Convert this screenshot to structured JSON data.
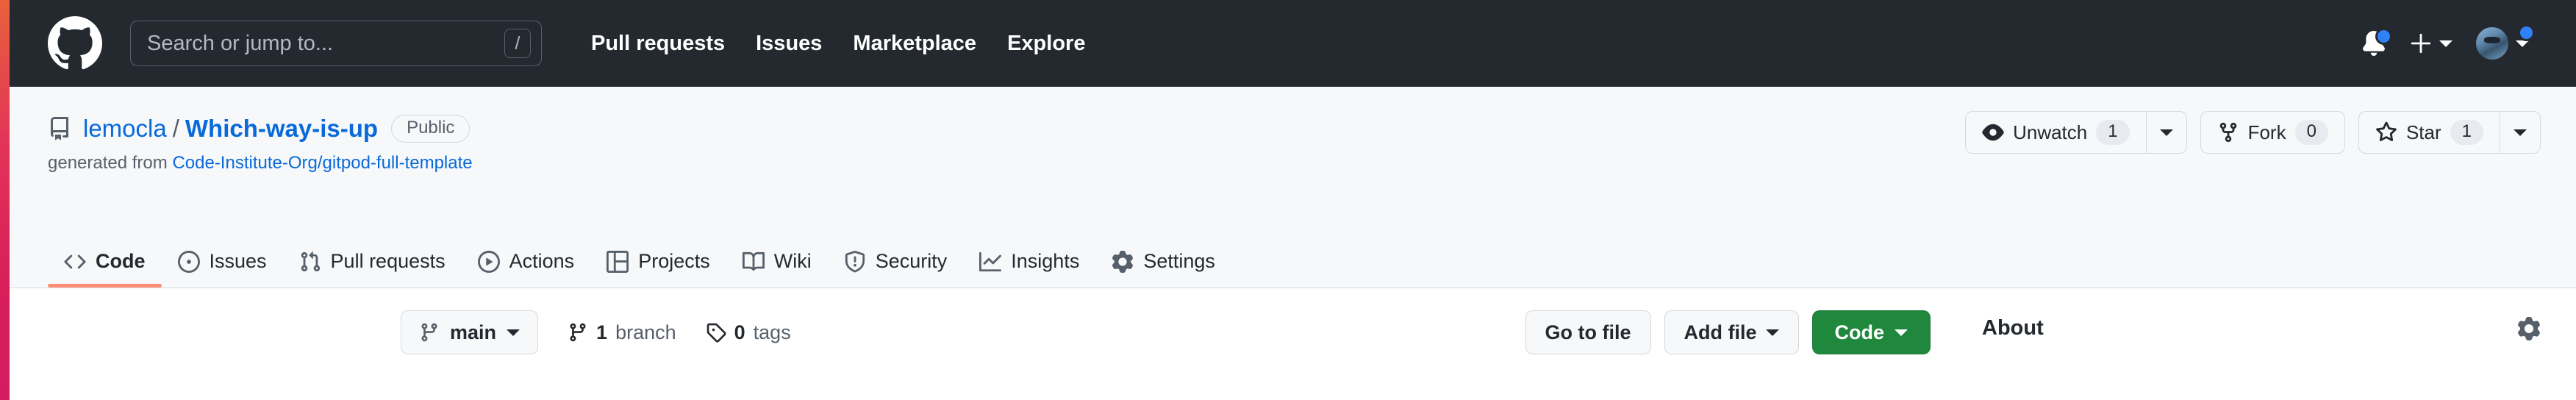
{
  "colors": {
    "header_bg": "#24292f",
    "repo_header_bg": "#f6f8fa",
    "link": "#0969da",
    "accent_underline": "#fd8c73",
    "code_button": "#1f883d",
    "notification_dot": "#2f81f7",
    "left_stripe": "#d81f5a"
  },
  "global_header": {
    "logo_icon": "github-mark-icon",
    "search": {
      "placeholder": "Search or jump to...",
      "value": "",
      "shortcut": "/"
    },
    "nav": [
      {
        "label": "Pull requests"
      },
      {
        "label": "Issues"
      },
      {
        "label": "Marketplace"
      },
      {
        "label": "Explore"
      }
    ],
    "right": {
      "notifications_icon": "bell-icon",
      "create_new_icon": "plus-icon",
      "avatar_icon": "avatar",
      "has_notification_dot": true
    }
  },
  "repo": {
    "icon": "repo-icon",
    "owner": "lemocla",
    "separator": "/",
    "name": "Which-way-is-up",
    "visibility": "Public",
    "generated_from_prefix": "generated from",
    "generated_from_link": "Code-Institute-Org/gitpod-full-template",
    "actions": {
      "watch": {
        "icon": "eye-icon",
        "label": "Unwatch",
        "count": "1"
      },
      "fork": {
        "icon": "fork-icon",
        "label": "Fork",
        "count": "0"
      },
      "star": {
        "icon": "star-icon",
        "label": "Star",
        "count": "1"
      }
    }
  },
  "tabs": [
    {
      "label": "Code",
      "icon": "code-icon",
      "active": true
    },
    {
      "label": "Issues",
      "icon": "issue-opened-icon",
      "active": false
    },
    {
      "label": "Pull requests",
      "icon": "git-pull-request-icon",
      "active": false
    },
    {
      "label": "Actions",
      "icon": "play-icon",
      "active": false
    },
    {
      "label": "Projects",
      "icon": "project-table-icon",
      "active": false
    },
    {
      "label": "Wiki",
      "icon": "book-icon",
      "active": false
    },
    {
      "label": "Security",
      "icon": "shield-icon",
      "active": false
    },
    {
      "label": "Insights",
      "icon": "graph-icon",
      "active": false
    },
    {
      "label": "Settings",
      "icon": "gear-icon",
      "active": false
    }
  ],
  "toolbar": {
    "branch": {
      "icon": "branch-icon",
      "name": "main"
    },
    "branch_count": {
      "icon": "branch-icon",
      "count": "1",
      "label": "branch"
    },
    "tag_count": {
      "icon": "tag-icon",
      "count": "0",
      "label": "tags"
    },
    "go_to_file": "Go to file",
    "add_file": "Add file",
    "code": "Code"
  },
  "about": {
    "heading": "About",
    "settings_icon": "gear-icon"
  }
}
